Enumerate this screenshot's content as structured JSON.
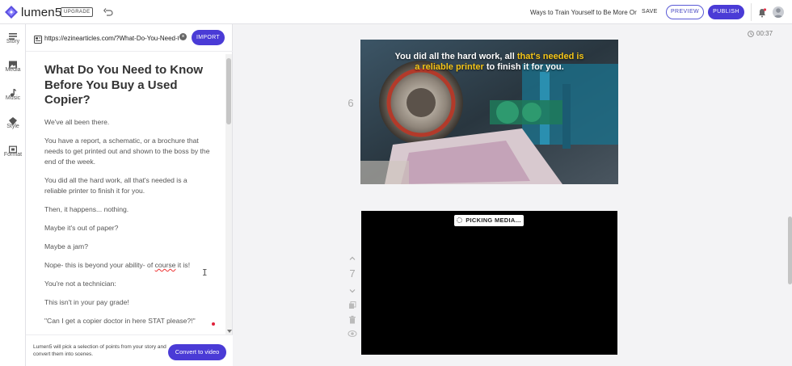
{
  "app": {
    "logo_text": "lumen5",
    "upgrade_label": "UPGRADE",
    "doc_title": "Ways to Train Yourself to Be More Organized",
    "save_label": "SAVE",
    "preview_label": "PREVIEW",
    "publish_label": "PUBLISH"
  },
  "rail": {
    "items": [
      {
        "label": "Story",
        "icon": "story-icon"
      },
      {
        "label": "Media",
        "icon": "media-icon"
      },
      {
        "label": "Music",
        "icon": "music-icon"
      },
      {
        "label": "Style",
        "icon": "style-icon"
      },
      {
        "label": "Format",
        "icon": "format-icon"
      }
    ]
  },
  "story": {
    "url_value": "https://ezinearticles.com/?What-Do-You-Need-to-Know-Before-You-Buy-a-Used-Copier",
    "import_label": "IMPORT",
    "title": "What Do You Need to Know Before You Buy a Used Copier?",
    "paragraphs": [
      "We've all been there.",
      "You have a report, a schematic, or a brochure that needs to get printed out and shown to the boss by the end of the week.",
      "You did all the hard work, all that's needed is a reliable printer to finish it for you.",
      "Then, it happens... nothing.",
      "Maybe it's out of paper?",
      "Maybe a jam?",
      "Nope- this is beyond your ability- of",
      "You're not a technician:",
      "This isn't in your pay grade!",
      "\"Can I get a copier doctor in here STAT please?!\""
    ],
    "para7_misspelled": "course",
    "para7_tail": " it is!",
    "footer_text": "Lumen5 will pick a selection of points from your story and convert them into scenes.",
    "convert_label": "Convert to video"
  },
  "canvas": {
    "duration": "00:37",
    "scenes": [
      {
        "number": "6",
        "caption_white_1": "You did all the hard work, all",
        "caption_highlight_1": "that's needed is",
        "caption_highlight_2": "a reliable printer",
        "caption_white_2": "to finish it for you."
      },
      {
        "number": "7",
        "status": "PICKING MEDIA..."
      }
    ]
  },
  "colors": {
    "accent": "#4a3bd6",
    "highlight": "#f5c518"
  }
}
